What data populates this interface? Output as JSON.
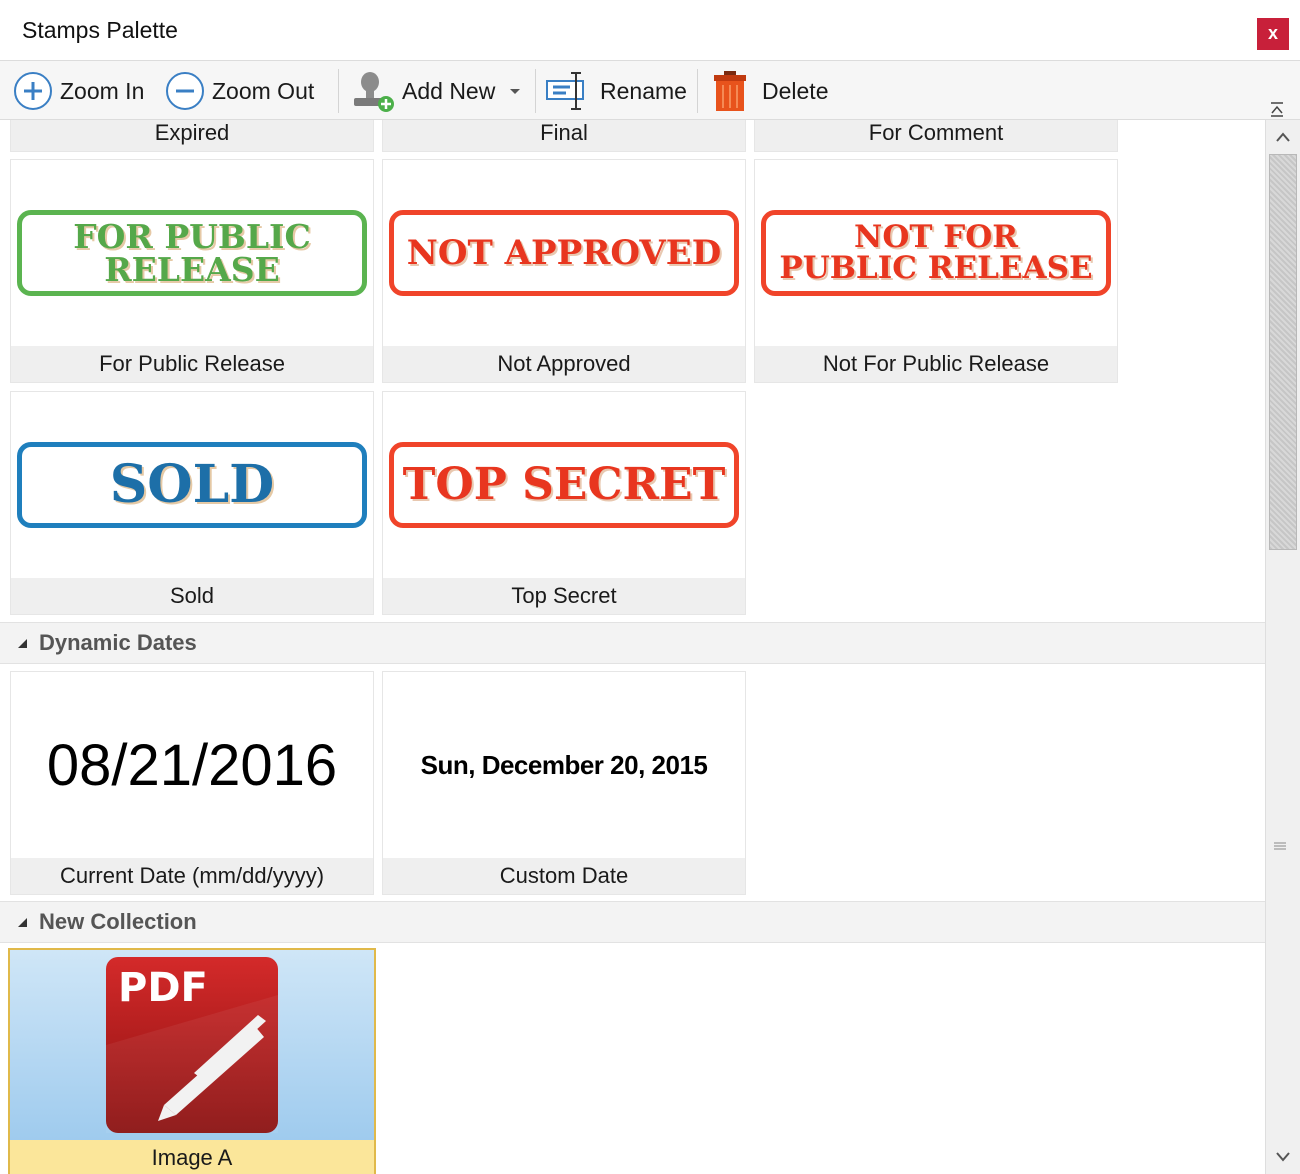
{
  "window": {
    "title": "Stamps Palette",
    "close_label": "x"
  },
  "toolbar": {
    "zoom_in": "Zoom In",
    "zoom_out": "Zoom Out",
    "add_new": "Add New",
    "rename": "Rename",
    "delete": "Delete"
  },
  "stamps": {
    "top_row_captions": [
      "Expired",
      "Final",
      "For Comment"
    ],
    "row2": [
      {
        "caption": "For Public Release",
        "line1": "FOR PUBLIC",
        "line2": "RELEASE",
        "color": "#5bb450"
      },
      {
        "caption": "Not Approved",
        "line1": "NOT APPROVED",
        "color": "#f0442a"
      },
      {
        "caption": "Not For Public Release",
        "line1": "NOT FOR",
        "line2": "PUBLIC RELEASE",
        "color": "#f0442a"
      }
    ],
    "row3": [
      {
        "caption": "Sold",
        "line1": "SOLD",
        "color": "#1f7fbd"
      },
      {
        "caption": "Top Secret",
        "line1": "TOP SECRET",
        "color": "#f0442a"
      }
    ]
  },
  "dynamic_dates": {
    "title": "Dynamic Dates",
    "items": [
      {
        "caption": "Current Date (mm/dd/yyyy)",
        "preview": "08/21/2016"
      },
      {
        "caption": "Custom Date",
        "preview": "Sun, December 20, 2015"
      }
    ]
  },
  "new_collection": {
    "title": "New Collection",
    "items": [
      {
        "caption": "Image A",
        "icon_text": "PDF",
        "icon": "pdf-xchange-logo-icon",
        "selected": true
      }
    ]
  }
}
